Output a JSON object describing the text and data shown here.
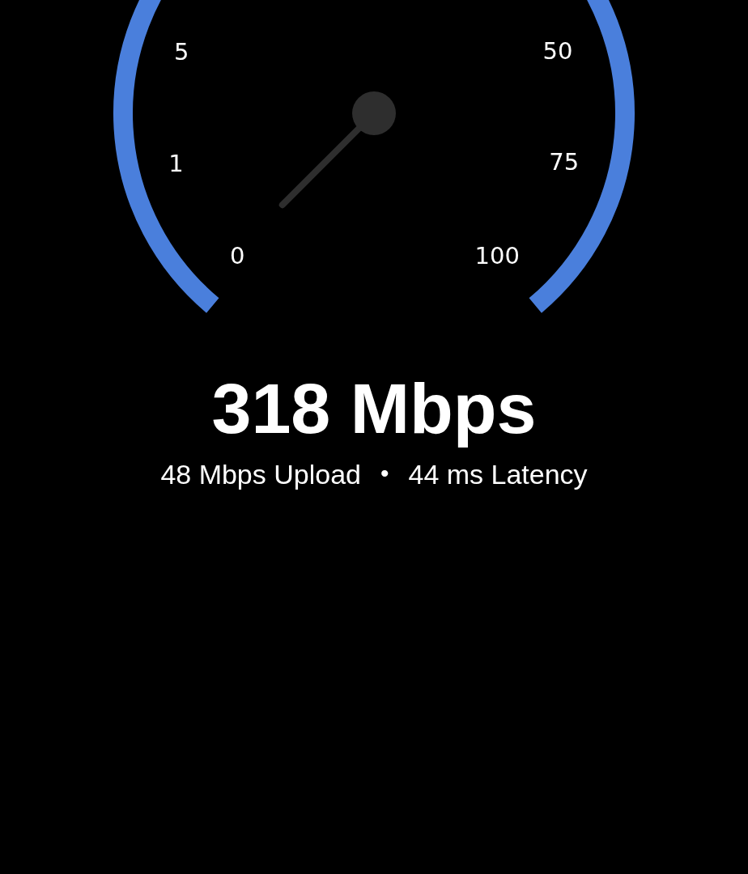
{
  "gauge": {
    "labels": [
      {
        "text": "0"
      },
      {
        "text": "1"
      },
      {
        "text": "5"
      },
      {
        "text": "50"
      },
      {
        "text": "75"
      },
      {
        "text": "100"
      }
    ]
  },
  "result": {
    "download": "318 Mbps",
    "upload": "48 Mbps Upload",
    "separator": "•",
    "latency": "44 ms Latency"
  }
}
